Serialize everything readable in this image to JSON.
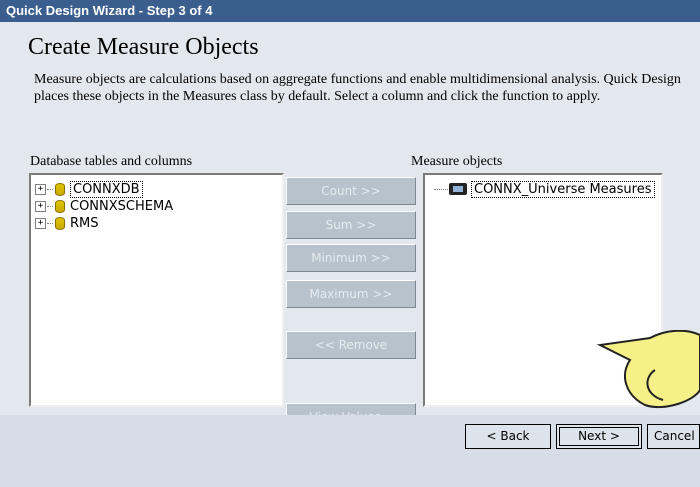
{
  "window": {
    "title": "Quick Design Wizard - Step 3 of 4"
  },
  "page": {
    "heading": "Create Measure Objects",
    "description": "Measure objects are calculations based on aggregate functions and enable multidimensional analysis. Quick Design places these objects in the Measures class by default. Select a column and click the function to apply."
  },
  "left_panel": {
    "label": "Database tables and columns",
    "items": [
      {
        "label": "CONNXDB",
        "expander": "+"
      },
      {
        "label": "CONNXSCHEMA",
        "expander": "+"
      },
      {
        "label": "RMS",
        "expander": "+"
      }
    ]
  },
  "right_panel": {
    "label": "Measure objects",
    "items": [
      {
        "label": "CONNX_Universe Measures"
      }
    ]
  },
  "actions": {
    "count": "Count >>",
    "sum": "Sum >>",
    "minimum": "Minimum >>",
    "maximum": "Maximum >>",
    "remove": "<< Remove",
    "view_values": "View Values..."
  },
  "footer": {
    "back": "< Back",
    "next": "Next >",
    "cancel": "Cancel"
  },
  "colors": {
    "titlebar": "#3a5f8f",
    "client": "#e3e8ee",
    "callout": "#f6f089"
  },
  "decor": {
    "callout_icon": "speech-bubble-callout-icon"
  }
}
